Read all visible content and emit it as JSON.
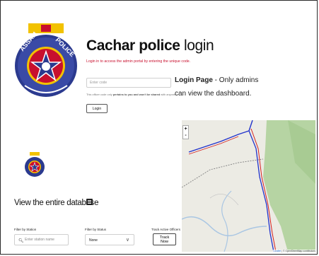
{
  "header": {
    "title_bold": "Cachar police",
    "title_light": "login",
    "subtitle": "Login in to access the admin portal by entering the unique code."
  },
  "login_form": {
    "code_placeholder": "Enter code",
    "note_prefix": "This officer code only ",
    "note_bold": "pertains to you and won't be shared",
    "note_suffix": " with anyone.",
    "login_label": "Login"
  },
  "info": {
    "heading": "Login Page",
    "text": " - Only admins can view the dashboard."
  },
  "map": {
    "zoom_in": "+",
    "zoom_out": "-",
    "attribution_link": "Leaflet",
    "attribution_text": " | © OpenStreetMap contributors"
  },
  "database": {
    "title": "View the entire database",
    "filter_station_label": "Filter by Station",
    "station_placeholder": "Enter station name",
    "filter_status_label": "Filter by Status",
    "status_value": "None",
    "track_label": "Track Active Officers",
    "track_button": "Track Now"
  },
  "colors": {
    "accent_red": "#c8102e",
    "route_blue": "#2233cc",
    "route_red": "#d62020",
    "forest_green": "#b6d4a3"
  },
  "icons": [
    "assam-police-emblem",
    "database-icon",
    "search-icon",
    "chevron-down-icon"
  ]
}
